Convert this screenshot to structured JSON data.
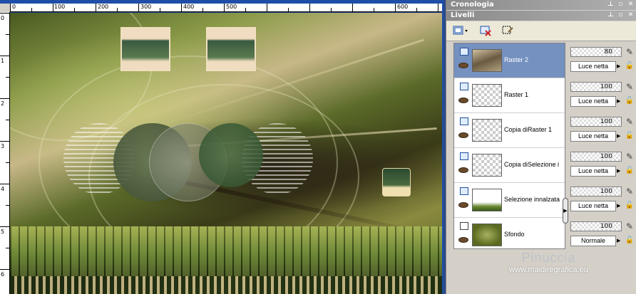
{
  "canvas": {
    "ruler_top_labels": [
      "0",
      "100",
      "200",
      "300",
      "400",
      "500",
      "600"
    ],
    "ruler_left_labels": [
      "0",
      "1",
      "2",
      "3",
      "4",
      "5",
      "6"
    ]
  },
  "panels": {
    "history_title": "Cronologia",
    "layers_title": "Livelli"
  },
  "layers": [
    {
      "name": "Raster 2",
      "opacity": "80",
      "blend": "Luce netta",
      "selected": true
    },
    {
      "name": "Raster 1",
      "opacity": "100",
      "blend": "Luce netta",
      "selected": false
    },
    {
      "name": "Copia diRaster 1",
      "opacity": "100",
      "blend": "Luce netta",
      "selected": false
    },
    {
      "name": "Copia diSelezione i",
      "opacity": "100",
      "blend": "Luce netta",
      "selected": false
    },
    {
      "name": "Selezione innalzata",
      "opacity": "100",
      "blend": "Luce netta",
      "selected": false
    },
    {
      "name": "Sfondo",
      "opacity": "100",
      "blend": "Normale",
      "selected": false
    }
  ],
  "watermark": {
    "name": "Pinuccia",
    "url": "www.maidiregrafica.eu"
  },
  "colors": {
    "selected_row": "#7591c0",
    "panel_bg": "#d4d0c8",
    "workspace_blue": "#1e4ea8"
  },
  "icons": [
    "new-layer-icon",
    "delete-layer-icon",
    "mask-icon",
    "eye-icon",
    "brush-icon",
    "lock-icon",
    "dropdown-arrow-icon"
  ]
}
